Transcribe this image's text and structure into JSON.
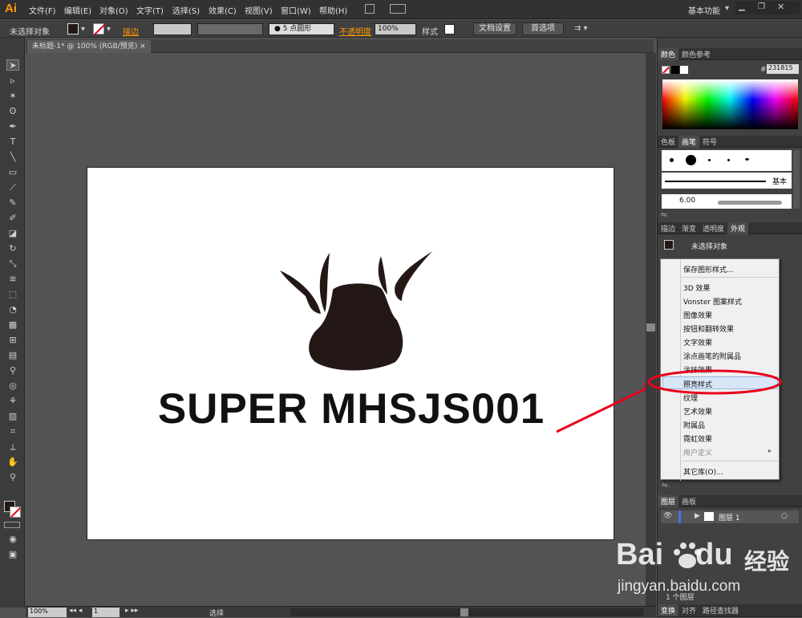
{
  "menubar": {
    "logo": "Ai",
    "items": [
      "文件(F)",
      "编辑(E)",
      "对象(O)",
      "文字(T)",
      "选择(S)",
      "效果(C)",
      "视图(V)",
      "窗口(W)",
      "帮助(H)"
    ],
    "workspace": "基本功能"
  },
  "control": {
    "selection": "未选择对象",
    "stroke_label": "描边",
    "brush": "5 点圆形",
    "opacity_label": "不透明度",
    "opacity": "100%",
    "style_label": "样式",
    "doc_settings": "文档设置",
    "preferences": "首选项"
  },
  "document": {
    "tab": "未标题-1* @ 100% (RGB/预览)",
    "close": "×"
  },
  "canvas": {
    "text": "SUPER MHSJS001"
  },
  "status": {
    "zoom": "100%",
    "page": "1",
    "tool": "选择"
  },
  "colors": {
    "accent": "#e8001c",
    "logo": "#ff9a00",
    "art": "#231815"
  },
  "panels": {
    "color": {
      "tabs": [
        "颜色",
        "颜色参考"
      ],
      "hex_label": "#",
      "hex": "231815"
    },
    "brushes": {
      "tabs": [
        "色板",
        "画笔",
        "符号"
      ],
      "basic": "基本",
      "size": "6.00"
    },
    "appearance": {
      "tabs": [
        "描边",
        "渐变",
        "透明度",
        "外观"
      ],
      "title": "未选择对象"
    },
    "layers": {
      "tabs": [
        "图层",
        "画板"
      ],
      "layer": "图层 1",
      "count": "1 个图层"
    },
    "bottom": {
      "tabs": [
        "变换",
        "对齐",
        "路径查找器"
      ]
    }
  },
  "context_menu": {
    "items": [
      "保存图形样式...",
      "3D 效果",
      "Vonster 图案样式",
      "图像效果",
      "按钮和翻转效果",
      "文字效果",
      "涂点画笔的附属品",
      "涂抹效果",
      "照亮样式",
      "纹理",
      "艺术效果",
      "附属品",
      "霓虹效果",
      "用户定义",
      "其它库(O)..."
    ],
    "highlighted": "照亮样式"
  },
  "watermark": {
    "brand": "Bai",
    "brand2": "du",
    "cn": "经验",
    "url": "jingyan.baidu.com"
  }
}
